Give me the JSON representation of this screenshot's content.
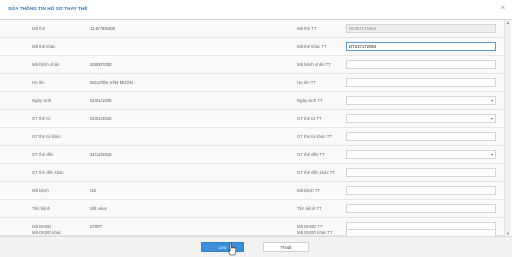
{
  "dialog": {
    "title": "SỬA THÔNG TIN HỒ SƠ THAY THẾ",
    "close": "×"
  },
  "rows": [
    {
      "l1": "Mã thẻ",
      "v1": "11-5/78/9406",
      "l2": "Mã thẻ TT",
      "v2": "0D357172054"
    },
    {
      "l1": "Mã thẻ khác",
      "v1": "",
      "l2": "Mã thẻ khác TT",
      "v2": "DT237172054"
    },
    {
      "l1": "Mã bệnh nhân",
      "v1": "200007030",
      "l2": "Mã bệnh nhân TT",
      "v2": ""
    },
    {
      "l1": "Họ tên",
      "v1": "NGUYỄN VĂN MUỘN",
      "l2": "Họ tên TT",
      "v2": ""
    },
    {
      "l1": "Ngày sinh",
      "v1": "01/01/1936",
      "l2": "Ngày sinh TT",
      "v2": ""
    },
    {
      "l1": "GT thẻ từ",
      "v1": "01/01/2016",
      "l2": "GT thẻ từ TT",
      "v2": ""
    },
    {
      "l1": "GT thẻ từ khác",
      "v1": "",
      "l2": "GT thẻ từ khác TT",
      "v2": ""
    },
    {
      "l1": "GT thẻ đến",
      "v1": "31/12/2016",
      "l2": "GT thẻ đến TT",
      "v2": ""
    },
    {
      "l1": "GT thẻ đến khác",
      "v1": "",
      "l2": "GT thẻ đến khác TT",
      "v2": ""
    },
    {
      "l1": "Mã bệnh",
      "v1": "I10",
      "l2": "Mã bệnh TT",
      "v2": ""
    },
    {
      "l1": "Tên bệnh",
      "v1": "Sốt virus",
      "l2": "Tên bệnh TT",
      "v2": ""
    },
    {
      "l1": "Mã DKBD",
      "v1": "27007",
      "l2": "Mã DKBD TT",
      "v2": ""
    },
    {
      "l1": "Mã DKBD khác",
      "v1": "",
      "l2": "Mã DKBD khác TT",
      "v2": ""
    }
  ],
  "buttons": {
    "save": "Lưu",
    "exit": "Thoát"
  },
  "colors": {
    "title": "#2a73b8",
    "primary_button": "#3c8fd8",
    "focus_border": "#5c9ed6"
  }
}
